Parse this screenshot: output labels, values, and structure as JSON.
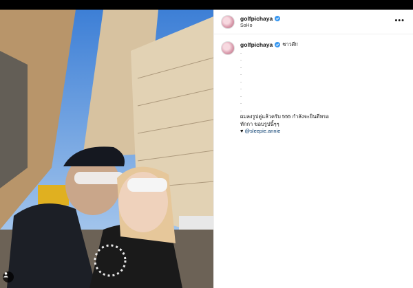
{
  "post": {
    "username": "golfpichaya",
    "location": "SoHo",
    "more_label": "•••",
    "caption": {
      "first_line": "ชาวดี!!",
      "dot_lines": [
        ".",
        ".",
        ".",
        ".",
        ".",
        ".",
        ".",
        ".",
        "."
      ],
      "line_1": "ผมลงรูปคู่แล้วครับ 555 กำลังจะยินดีหรอ",
      "line_2": "ทักกา ขอบรูปนี้ๆๆ",
      "heart": "♥",
      "mention": "@sleepie.annie"
    }
  },
  "icons": {
    "verified": "verified-badge-icon",
    "user_tag": "user-tag-icon",
    "more": "more-options-icon"
  },
  "colors": {
    "verified": "#3897f0",
    "mention": "#00376b"
  }
}
